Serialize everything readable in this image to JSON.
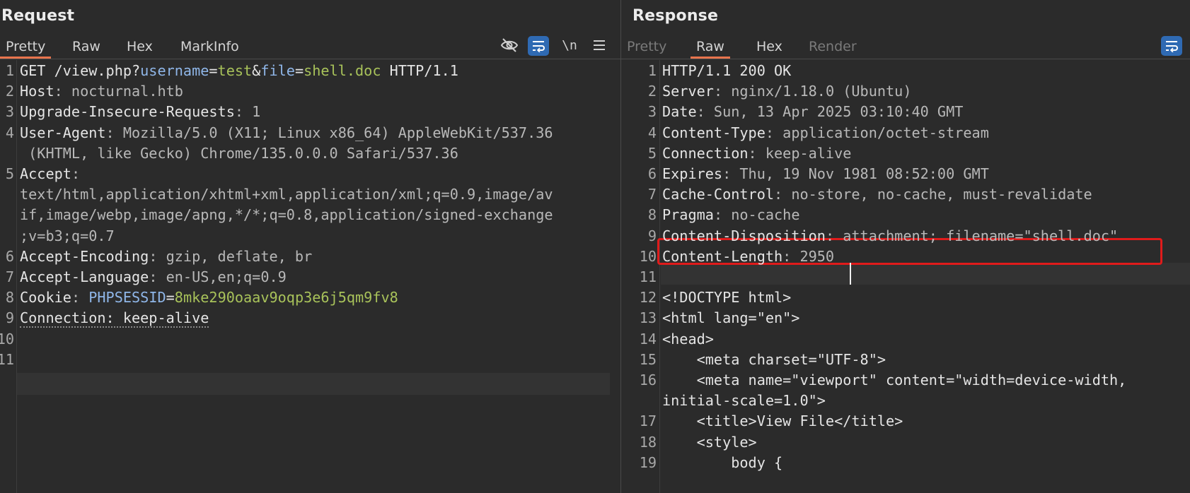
{
  "request": {
    "title": "Request",
    "tabs": [
      "Pretty",
      "Raw",
      "Hex",
      "MarkInfo"
    ],
    "active_tab": "Pretty",
    "tools": {
      "hide_icon": "eye-slash-icon",
      "wrap_icon": "word-wrap-icon",
      "newline_label": "\\n",
      "menu_icon": "hamburger-menu-icon"
    },
    "lines": [
      {
        "num": "1",
        "parts": [
          {
            "t": "GET /view.php?",
            "c": "k"
          },
          {
            "t": "username",
            "c": "p"
          },
          {
            "t": "=",
            "c": "k"
          },
          {
            "t": "test",
            "c": "pv"
          },
          {
            "t": "&",
            "c": "k"
          },
          {
            "t": "file",
            "c": "p"
          },
          {
            "t": "=",
            "c": "k"
          },
          {
            "t": "shell.doc",
            "c": "pv"
          },
          {
            "t": " HTTP/1.1",
            "c": "k"
          }
        ]
      },
      {
        "num": "2",
        "parts": [
          {
            "t": "Host",
            "c": "k"
          },
          {
            "t": ": nocturnal.htb",
            "c": "v"
          }
        ]
      },
      {
        "num": "3",
        "parts": [
          {
            "t": "Upgrade-Insecure-Requests",
            "c": "k"
          },
          {
            "t": ": 1",
            "c": "v"
          }
        ]
      },
      {
        "num": "4",
        "parts": [
          {
            "t": "User-Agent",
            "c": "k"
          },
          {
            "t": ": Mozilla/5.0 (X11; Linux x86_64) AppleWebKit/537.36",
            "c": "v"
          }
        ]
      },
      {
        "num": "",
        "parts": [
          {
            "t": " (KHTML, like Gecko) Chrome/135.0.0.0 Safari/537.36",
            "c": "v"
          }
        ]
      },
      {
        "num": "5",
        "parts": [
          {
            "t": "Accept",
            "c": "k"
          },
          {
            "t": ":",
            "c": "v"
          }
        ]
      },
      {
        "num": "",
        "parts": [
          {
            "t": "text/html,application/xhtml+xml,application/xml;q=0.9,image/av",
            "c": "v"
          }
        ]
      },
      {
        "num": "",
        "parts": [
          {
            "t": "if,image/webp,image/apng,*/*;q=0.8,application/signed-exchange",
            "c": "v"
          }
        ]
      },
      {
        "num": "",
        "parts": [
          {
            "t": ";v=b3;q=0.7",
            "c": "v"
          }
        ]
      },
      {
        "num": "6",
        "parts": [
          {
            "t": "Accept-Encoding",
            "c": "k"
          },
          {
            "t": ": gzip, deflate, br",
            "c": "v"
          }
        ]
      },
      {
        "num": "7",
        "parts": [
          {
            "t": "Accept-Language",
            "c": "k"
          },
          {
            "t": ": en-US,en;q=0.9",
            "c": "v"
          }
        ]
      },
      {
        "num": "8",
        "parts": [
          {
            "t": "Cookie",
            "c": "k"
          },
          {
            "t": ": ",
            "c": "v"
          },
          {
            "t": "PHPSESSID",
            "c": "p"
          },
          {
            "t": "=",
            "c": "k"
          },
          {
            "t": "8mke290oaav9oqp3e6j5qm9fv8",
            "c": "pv"
          }
        ]
      },
      {
        "num": "9",
        "parts": [
          {
            "t": "Connection: keep-alive",
            "c": "k dotted"
          }
        ]
      },
      {
        "num": "10",
        "parts": []
      },
      {
        "num": "11",
        "parts": []
      }
    ]
  },
  "response": {
    "title": "Response",
    "tabs": [
      "Pretty",
      "Raw",
      "Hex",
      "Render"
    ],
    "active_tab": "Raw",
    "disabled_tabs": [
      "Pretty",
      "Render"
    ],
    "tools": {
      "wrap_icon": "word-wrap-icon"
    },
    "lines": [
      {
        "num": "1",
        "parts": [
          {
            "t": "HTTP/1.1 200 OK",
            "c": "k"
          }
        ]
      },
      {
        "num": "2",
        "parts": [
          {
            "t": "Server",
            "c": "k"
          },
          {
            "t": ": nginx/1.18.0 (Ubuntu)",
            "c": "v"
          }
        ]
      },
      {
        "num": "3",
        "parts": [
          {
            "t": "Date",
            "c": "k"
          },
          {
            "t": ": Sun, 13 Apr 2025 03:10:40 GMT",
            "c": "v"
          }
        ]
      },
      {
        "num": "4",
        "parts": [
          {
            "t": "Content-Type",
            "c": "k"
          },
          {
            "t": ": application/octet-stream",
            "c": "v"
          }
        ]
      },
      {
        "num": "5",
        "parts": [
          {
            "t": "Connection",
            "c": "k"
          },
          {
            "t": ": keep-alive",
            "c": "v"
          }
        ]
      },
      {
        "num": "6",
        "parts": [
          {
            "t": "Expires",
            "c": "k"
          },
          {
            "t": ": Thu, 19 Nov 1981 08:52:00 GMT",
            "c": "v"
          }
        ]
      },
      {
        "num": "7",
        "parts": [
          {
            "t": "Cache-Control",
            "c": "k"
          },
          {
            "t": ": no-store, no-cache, must-revalidate",
            "c": "v"
          }
        ]
      },
      {
        "num": "8",
        "parts": [
          {
            "t": "Pragma",
            "c": "k"
          },
          {
            "t": ": no-cache",
            "c": "v"
          }
        ]
      },
      {
        "num": "9",
        "parts": [
          {
            "t": "Content-Disposition",
            "c": "k"
          },
          {
            "t": ": attachment; filename=\"shell.doc\"",
            "c": "v"
          }
        ]
      },
      {
        "num": "10",
        "parts": [
          {
            "t": "Content-Length",
            "c": "k"
          },
          {
            "t": ": 2950",
            "c": "v"
          }
        ]
      },
      {
        "num": "11",
        "parts": []
      },
      {
        "num": "12",
        "parts": [
          {
            "t": "<!DOCTYPE html>",
            "c": "k"
          }
        ]
      },
      {
        "num": "13",
        "parts": [
          {
            "t": "<html lang=\"en\">",
            "c": "k"
          }
        ]
      },
      {
        "num": "14",
        "parts": [
          {
            "t": "<head>",
            "c": "k"
          }
        ]
      },
      {
        "num": "15",
        "parts": [
          {
            "t": "    <meta charset=\"UTF-8\">",
            "c": "k"
          }
        ]
      },
      {
        "num": "16",
        "parts": [
          {
            "t": "    <meta name=\"viewport\" content=\"width=device-width,",
            "c": "k"
          }
        ]
      },
      {
        "num": "",
        "parts": [
          {
            "t": "initial-scale=1.0\">",
            "c": "k"
          }
        ]
      },
      {
        "num": "17",
        "parts": [
          {
            "t": "    <title>View File</title>",
            "c": "k"
          }
        ]
      },
      {
        "num": "18",
        "parts": [
          {
            "t": "    <style>",
            "c": "k"
          }
        ]
      },
      {
        "num": "19",
        "parts": [
          {
            "t": "        body {",
            "c": "k"
          }
        ]
      }
    ]
  }
}
